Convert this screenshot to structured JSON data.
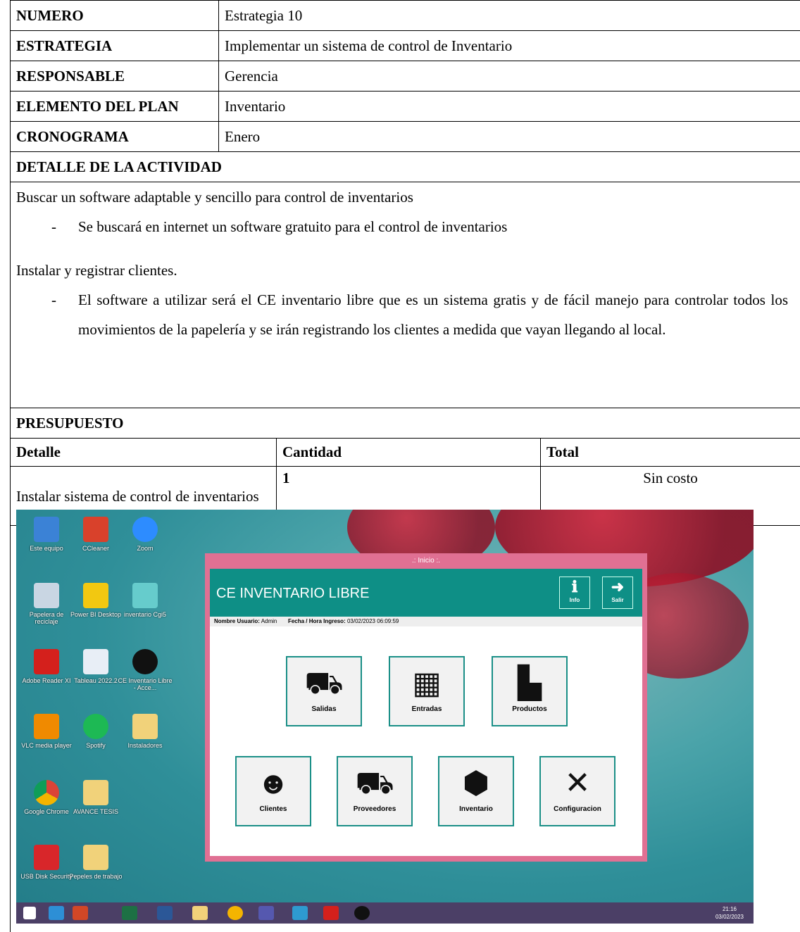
{
  "header_rows": [
    {
      "label": "NUMERO",
      "value": "Estrategia 10"
    },
    {
      "label": "ESTRATEGIA",
      "value": "Implementar un sistema de control de Inventario"
    },
    {
      "label": "RESPONSABLE",
      "value": "Gerencia"
    },
    {
      "label": "ELEMENTO DEL PLAN",
      "value": "Inventario"
    },
    {
      "label": "CRONOGRAMA",
      "value": "Enero"
    }
  ],
  "detail": {
    "title": "DETALLE DE LA ACTIVIDAD",
    "line1": "Buscar un software adaptable y sencillo para control de inventarios",
    "dash": "-",
    "bullet1": "Se buscará en internet un software gratuito para el control de inventarios",
    "line2": "Instalar y registrar clientes.",
    "bullet2": "El software a utilizar será el CE inventario libre que es un sistema gratis y de fácil manejo para controlar todos los movimientos de la papelería y se irán registrando los clientes a medida que vayan llegando al local."
  },
  "budget": {
    "title": "PRESUPUESTO",
    "col1": "Detalle",
    "col2": "Cantidad",
    "col3": "Total",
    "detail": "Instalar sistema de control de inventarios",
    "qty": "1",
    "total": "Sin costo"
  },
  "screenshot": {
    "desktop_icons": [
      "Este equipo",
      "CCleaner",
      "Zoom",
      "Papelera de reciclaje",
      "Power BI Desktop",
      "inventario Cgi5",
      "Adobe Reader XI",
      "Tableau 2022.2",
      "CE Inventario Libre - Acce...",
      "VLC media player",
      "Spotify",
      "Instaladores",
      "Google Chrome",
      "AVANCE TESIS",
      "USB Disk Security",
      "Pepeles de trabajo"
    ],
    "window_title": ".: Inicio :.",
    "app_title": "CE INVENTARIO LIBRE",
    "info_btn": "Info",
    "exit_btn": "Salir",
    "user_label": "Nombre Usuario:",
    "user_value": "Admin",
    "date_label": "Fecha / Hora Ingreso:",
    "date_value": "03/02/2023 06:09:59",
    "tiles": [
      "Salidas",
      "Entradas",
      "Productos",
      "Clientes",
      "Proveedores",
      "Inventario",
      "Configuracion"
    ],
    "clock_time": "21:16",
    "clock_date": "03/02/2023",
    "colors": {
      "teal": "#0e8f86",
      "window_border": "#e07093",
      "taskbar": "#4b3f66"
    }
  }
}
